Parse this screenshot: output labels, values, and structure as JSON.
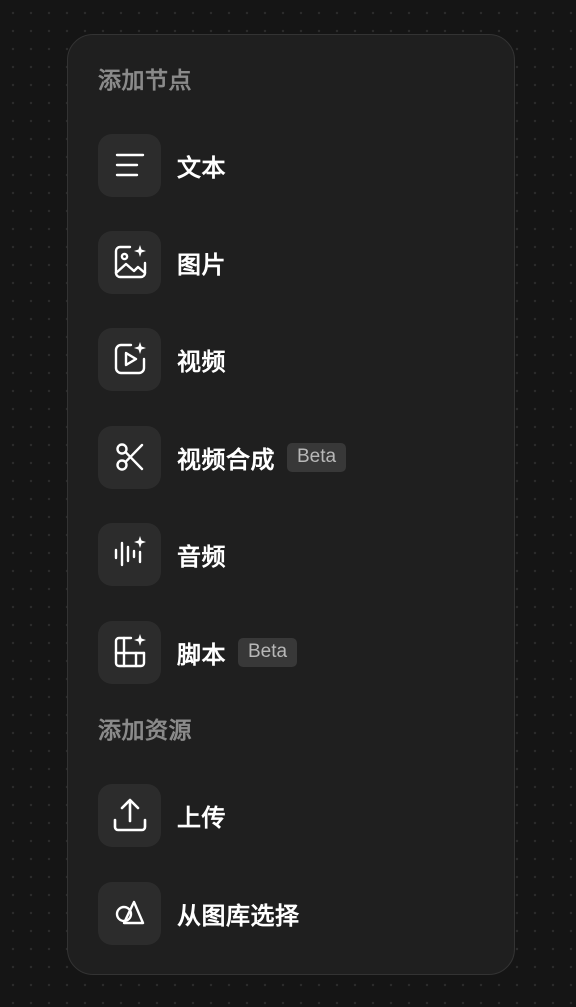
{
  "nodes_section": {
    "title": "添加节点",
    "items": [
      {
        "label": "文本",
        "icon": "text-icon"
      },
      {
        "label": "图片",
        "icon": "image-sparkle-icon"
      },
      {
        "label": "视频",
        "icon": "video-sparkle-icon"
      },
      {
        "label": "视频合成",
        "icon": "scissors-icon",
        "badge": "Beta"
      },
      {
        "label": "音频",
        "icon": "audio-waveform-sparkle-icon"
      },
      {
        "label": "脚本",
        "icon": "film-script-sparkle-icon",
        "badge": "Beta"
      }
    ]
  },
  "resources_section": {
    "title": "添加资源",
    "items": [
      {
        "label": "上传",
        "icon": "upload-icon"
      },
      {
        "label": "从图库选择",
        "icon": "shapes-library-icon"
      }
    ]
  },
  "colors": {
    "background": "#151515",
    "panel": "#1f1f1f",
    "icon_box": "#2c2c2c",
    "label": "#ffffff",
    "section_title": "#8a8a8a",
    "badge_bg": "#383838",
    "badge_text": "#b8b8b8"
  }
}
